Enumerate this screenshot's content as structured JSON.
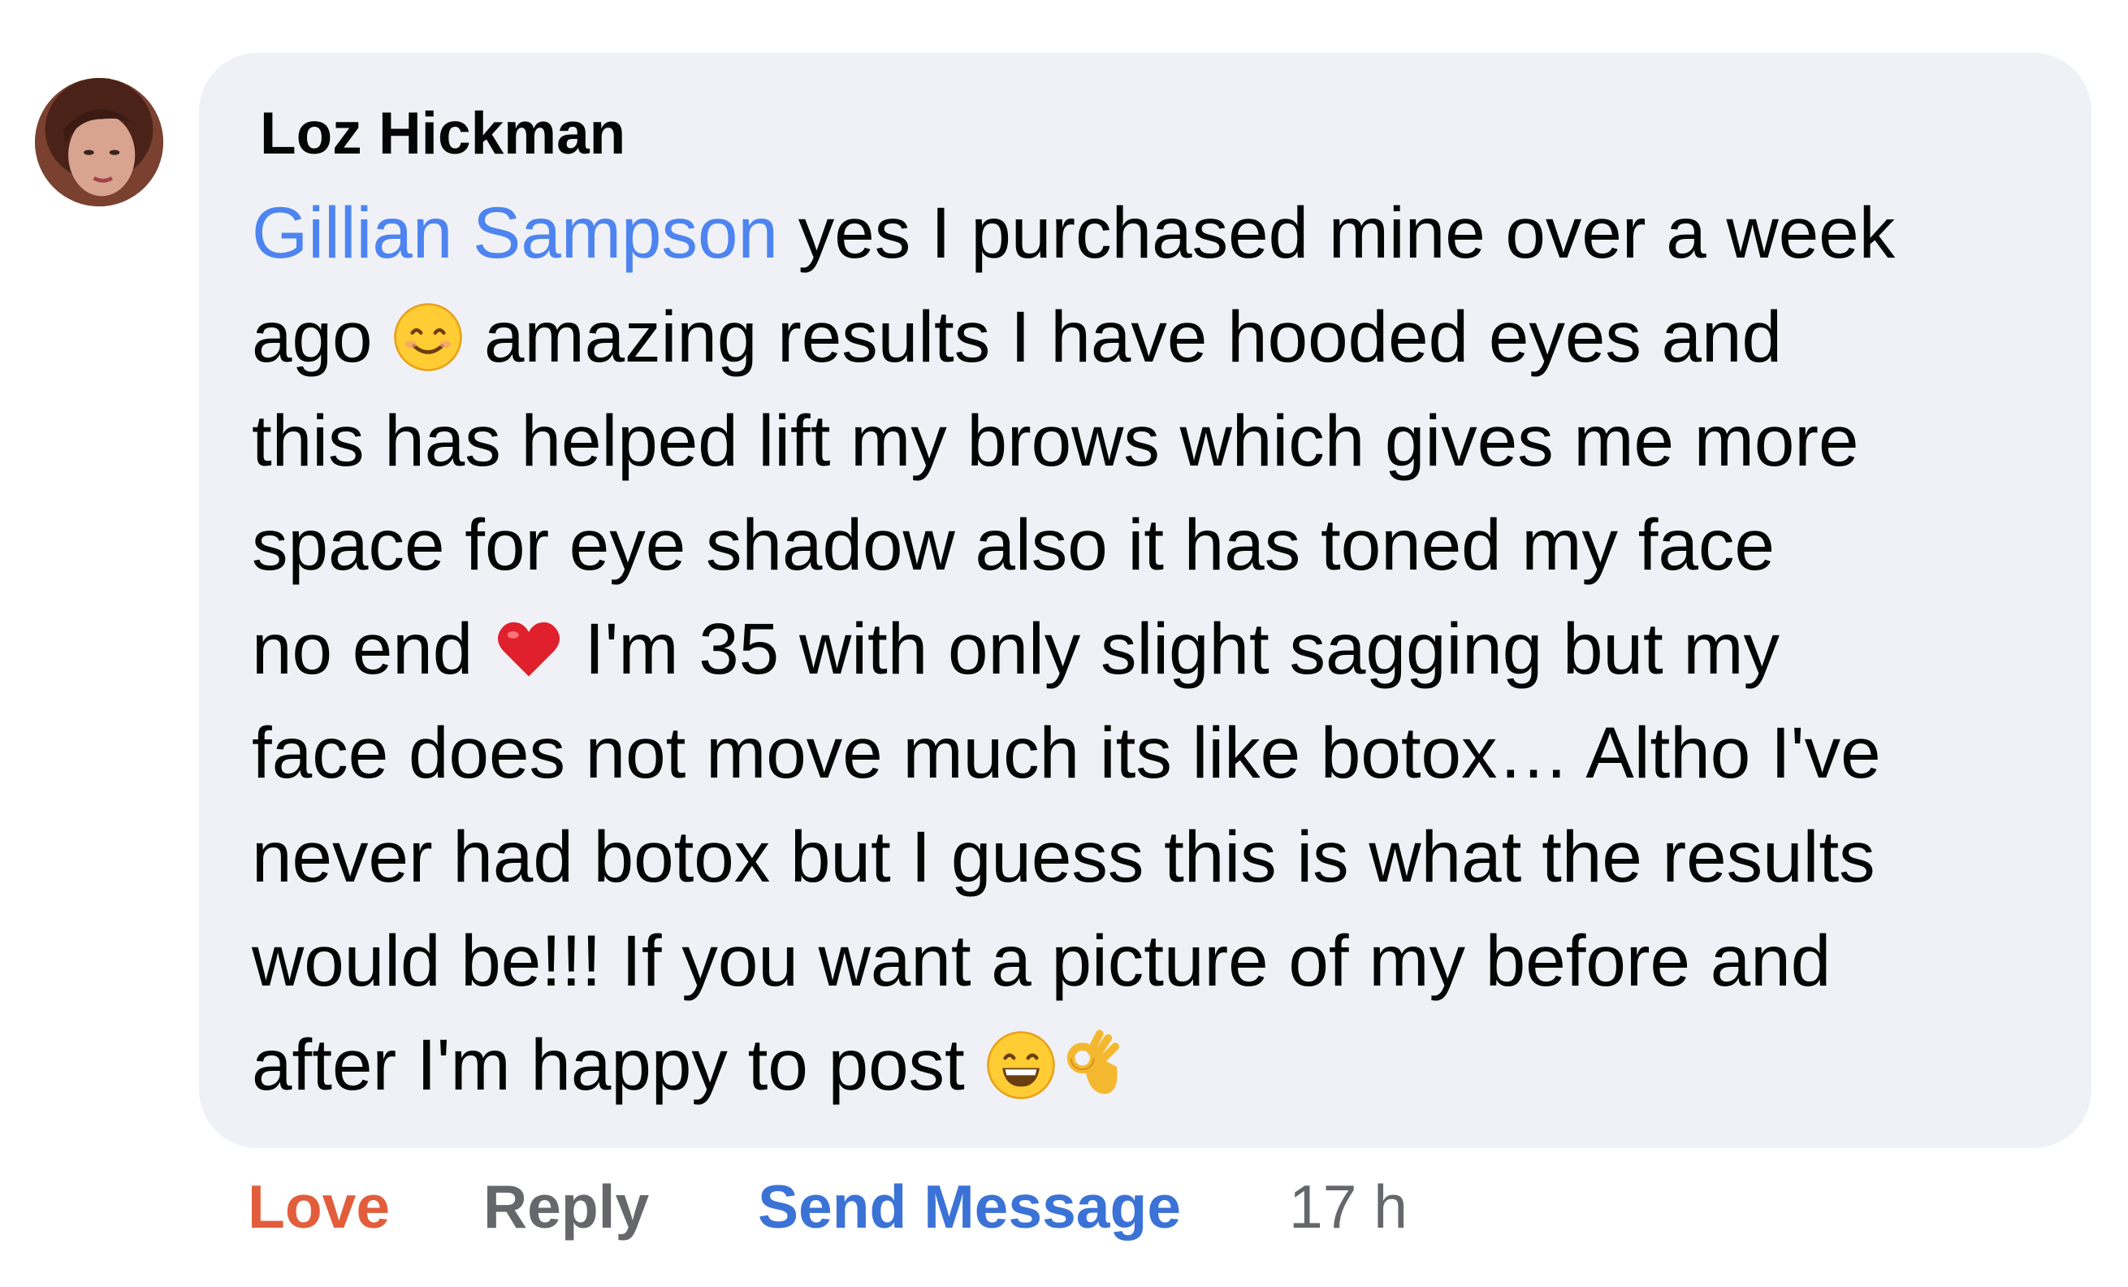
{
  "comment": {
    "author": "Loz Hickman",
    "mention": "Gillian Sampson",
    "lines": [
      {
        "before": "",
        "after": " yes I purchased mine over a week"
      },
      {
        "text1": "ago ",
        "emoji": "smiling-face-icon",
        "text2": " amazing results I have hooded eyes and"
      },
      {
        "text": "this has helped lift my brows which gives me more"
      },
      {
        "text": "space for eye shadow also it has toned my face"
      },
      {
        "text1": "no end ",
        "emoji": "red-heart-icon",
        "text2": " I'm 35 with only slight sagging but my"
      },
      {
        "text": "face does not move much its like botox… Altho I've"
      },
      {
        "text": "never had botox but I guess this is what the results"
      },
      {
        "text": "would be!!! If you want a picture of my before and"
      },
      {
        "text1": "after I'm happy to post ",
        "emoji": "grinning-face-icon",
        "emoji2": "ok-hand-icon"
      }
    ]
  },
  "actions": {
    "love": "Love",
    "reply": "Reply",
    "send_message": "Send Message",
    "timestamp": "17 h"
  },
  "colors": {
    "bubble": "#f0f1f6",
    "mention": "#4d84f0",
    "love": "#e25d3b",
    "send_message": "#3b72d6",
    "muted": "#65676b"
  }
}
